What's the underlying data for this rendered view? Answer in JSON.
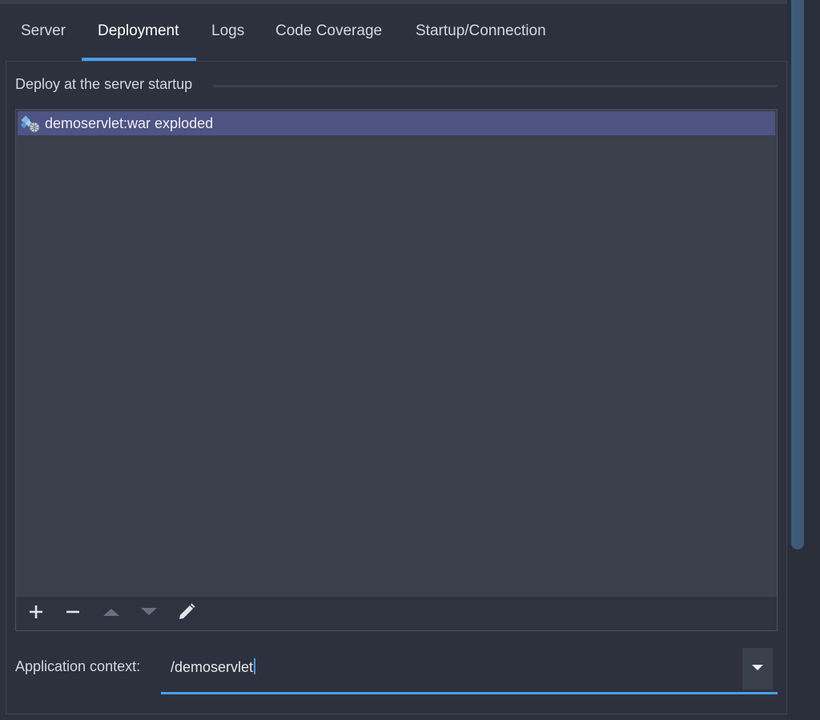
{
  "tabs": [
    {
      "label": "Server"
    },
    {
      "label": "Deployment"
    },
    {
      "label": "Logs"
    },
    {
      "label": "Code Coverage"
    },
    {
      "label": "Startup/Connection"
    }
  ],
  "active_tab": "Deployment",
  "section": {
    "title": "Deploy at the server startup"
  },
  "deploy_list": {
    "items": [
      {
        "label": "demoservlet:war exploded",
        "icon": "artifact-web-icon",
        "selected": true
      }
    ],
    "toolbar": {
      "add": "add-icon",
      "remove": "remove-icon",
      "move_up": "move-up-icon",
      "move_down": "move-down-icon",
      "edit": "edit-icon"
    }
  },
  "context": {
    "label": "Application context:",
    "value": "/demoservlet"
  },
  "colors": {
    "accent": "#4a9ee8",
    "selection": "#4e5484",
    "background": "#2d313d"
  }
}
